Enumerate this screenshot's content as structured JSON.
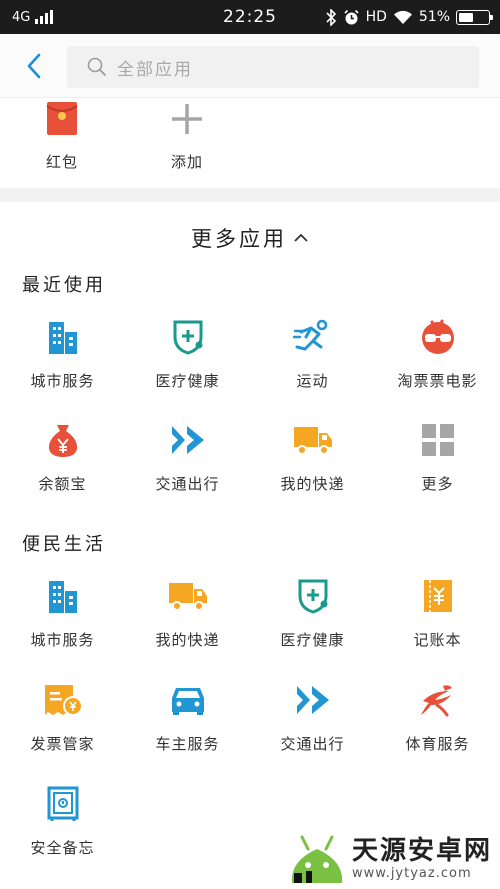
{
  "status_bar": {
    "network": "4G",
    "time": "22:25",
    "hd": "HD",
    "battery": "51%",
    "battery_level": 0.51
  },
  "search": {
    "placeholder": "全部应用"
  },
  "favorites": [
    {
      "label": "红包",
      "icon": "red-envelope-icon"
    },
    {
      "label": "添加",
      "icon": "plus-icon"
    }
  ],
  "more_apps": {
    "label": "更多应用"
  },
  "sections": [
    {
      "title": "最近使用",
      "apps": [
        {
          "label": "城市服务",
          "icon": "city-building-icon"
        },
        {
          "label": "医疗健康",
          "icon": "medical-shield-icon"
        },
        {
          "label": "运动",
          "icon": "running-person-icon"
        },
        {
          "label": "淘票票电影",
          "icon": "movie-glasses-icon"
        },
        {
          "label": "余额宝",
          "icon": "money-bag-icon"
        },
        {
          "label": "交通出行",
          "icon": "double-chevron-icon"
        },
        {
          "label": "我的快递",
          "icon": "delivery-truck-icon"
        },
        {
          "label": "更多",
          "icon": "grid-more-icon"
        }
      ]
    },
    {
      "title": "便民生活",
      "apps": [
        {
          "label": "城市服务",
          "icon": "city-building-icon"
        },
        {
          "label": "我的快递",
          "icon": "delivery-truck-icon"
        },
        {
          "label": "医疗健康",
          "icon": "medical-shield-icon"
        },
        {
          "label": "记账本",
          "icon": "ledger-icon"
        },
        {
          "label": "发票管家",
          "icon": "invoice-icon"
        },
        {
          "label": "车主服务",
          "icon": "car-icon"
        },
        {
          "label": "交通出行",
          "icon": "double-chevron-icon"
        },
        {
          "label": "体育服务",
          "icon": "sports-icon"
        },
        {
          "label": "安全备忘",
          "icon": "safe-box-icon"
        }
      ]
    }
  ],
  "watermark": {
    "title": "天源安卓网",
    "url": "www.jytyaz.com"
  },
  "colors": {
    "accent_blue": "#2196d3",
    "teal": "#1a9a8c",
    "orange": "#f5a623",
    "red": "#e8503a",
    "gray_icon": "#a6a6a6"
  }
}
